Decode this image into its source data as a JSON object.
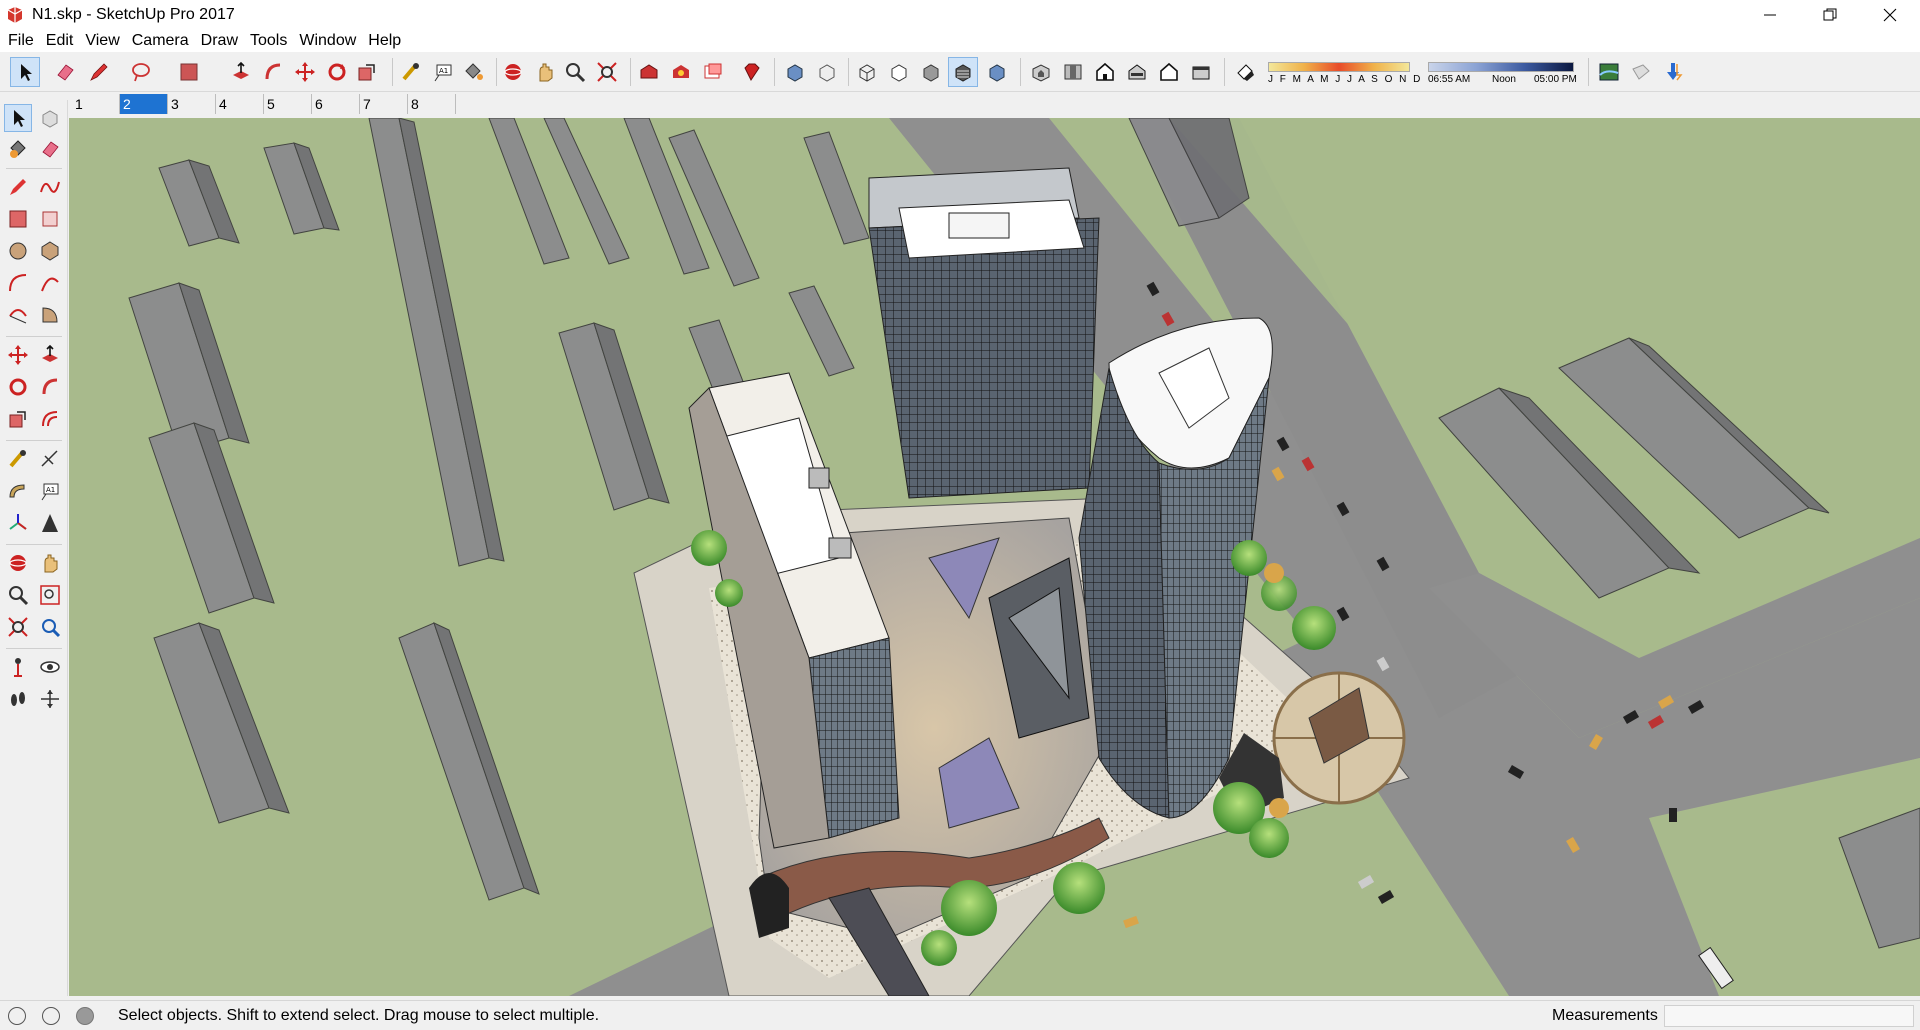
{
  "window": {
    "title": "N1.skp - SketchUp Pro 2017",
    "controls": [
      "minimize",
      "restore",
      "close"
    ]
  },
  "menu": [
    "File",
    "Edit",
    "View",
    "Camera",
    "Draw",
    "Tools",
    "Window",
    "Help"
  ],
  "scenes": {
    "tabs": [
      "1",
      "2",
      "3",
      "4",
      "5",
      "6",
      "7",
      "8"
    ],
    "active_index": 1
  },
  "shadow_settings": {
    "months": "J F M A M J J A S O N D",
    "time_start": "06:55 AM",
    "time_mid": "Noon",
    "time_end": "05:00 PM"
  },
  "status": {
    "message": "Select objects. Shift to extend select. Drag mouse to select multiple.",
    "measurements_label": "Measurements",
    "measurements_value": ""
  },
  "colors": {
    "ground": "#a8ba8c",
    "road": "#8d8d8d",
    "building": "#8a8a8e",
    "active_tab": "#1e73d2",
    "accent_red": "#d23a2a"
  },
  "icons": {
    "toolbar": [
      "select-icon",
      "eraser-icon",
      "pencil-icon",
      "lasso-icon",
      "paint-icon",
      "push-pull-icon",
      "follow-me-icon",
      "move-icon",
      "rotate-icon",
      "scale-icon",
      "tape-icon",
      "text-icon",
      "paint-bucket-icon",
      "orbit-icon",
      "pan-icon",
      "zoom-icon",
      "zoom-extents-icon",
      "warehouse-icon",
      "extension-warehouse-icon",
      "layout-icon",
      "ruby-icon",
      "xray-icon",
      "back-edges-icon",
      "wireframe-icon",
      "hidden-line-icon",
      "shaded-icon",
      "shaded-textures-icon",
      "monochrome-icon",
      "iso-icon",
      "top-icon",
      "front-icon",
      "right-icon",
      "back-icon",
      "left-icon",
      "shadows-icon",
      "sandbox-icon",
      "solid-icon",
      "download-icon"
    ]
  }
}
